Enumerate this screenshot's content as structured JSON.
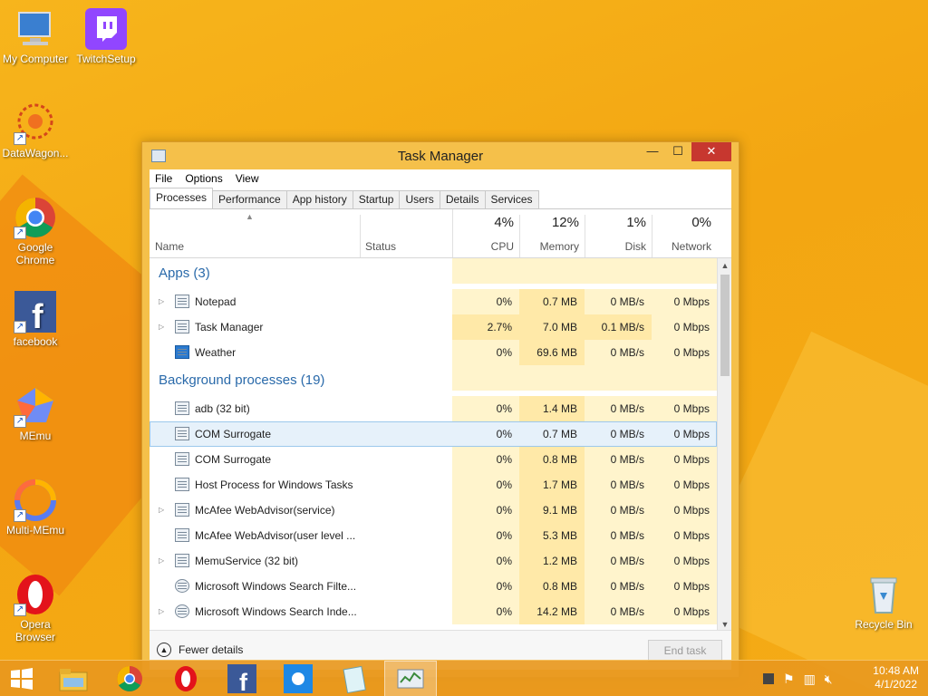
{
  "desktop": {
    "icons": [
      {
        "label": "My Computer",
        "icon": "computer-icon"
      },
      {
        "label": "TwitchSetup",
        "icon": "twitch-icon"
      },
      {
        "label": "DataWagon...",
        "icon": "datawagon-icon"
      },
      {
        "label": "Google Chrome",
        "icon": "chrome-icon"
      },
      {
        "label": "facebook",
        "icon": "facebook-icon"
      },
      {
        "label": "MEmu",
        "icon": "memu-icon"
      },
      {
        "label": "Multi-MEmu",
        "icon": "multi-memu-icon"
      },
      {
        "label": "Opera Browser",
        "icon": "opera-icon"
      },
      {
        "label": "Recycle Bin",
        "icon": "recycle-bin-icon"
      }
    ]
  },
  "window": {
    "title": "Task Manager",
    "controls": {
      "minimize": "—",
      "maximize": "☐",
      "close": "✕"
    }
  },
  "menu": [
    "File",
    "Options",
    "View"
  ],
  "tabs": [
    "Processes",
    "Performance",
    "App history",
    "Startup",
    "Users",
    "Details",
    "Services"
  ],
  "columns": {
    "name": "Name",
    "status": "Status",
    "cpu": {
      "pct": "4%",
      "label": "CPU"
    },
    "memory": {
      "pct": "12%",
      "label": "Memory"
    },
    "disk": {
      "pct": "1%",
      "label": "Disk"
    },
    "network": {
      "pct": "0%",
      "label": "Network"
    }
  },
  "groups": {
    "apps": "Apps (3)",
    "background": "Background processes (19)"
  },
  "apps": [
    {
      "name": "Notepad",
      "cpu": "0%",
      "mem": "0.7 MB",
      "disk": "0 MB/s",
      "net": "0 Mbps"
    },
    {
      "name": "Task Manager",
      "cpu": "2.7%",
      "mem": "7.0 MB",
      "disk": "0.1 MB/s",
      "net": "0 Mbps"
    },
    {
      "name": "Weather",
      "cpu": "0%",
      "mem": "69.6 MB",
      "disk": "0 MB/s",
      "net": "0 Mbps"
    }
  ],
  "background": [
    {
      "name": "adb (32 bit)",
      "cpu": "0%",
      "mem": "1.4 MB",
      "disk": "0 MB/s",
      "net": "0 Mbps"
    },
    {
      "name": "COM Surrogate",
      "cpu": "0%",
      "mem": "0.7 MB",
      "disk": "0 MB/s",
      "net": "0 Mbps"
    },
    {
      "name": "COM Surrogate",
      "cpu": "0%",
      "mem": "0.8 MB",
      "disk": "0 MB/s",
      "net": "0 Mbps"
    },
    {
      "name": "Host Process for Windows Tasks",
      "cpu": "0%",
      "mem": "1.7 MB",
      "disk": "0 MB/s",
      "net": "0 Mbps"
    },
    {
      "name": "McAfee WebAdvisor(service)",
      "cpu": "0%",
      "mem": "9.1 MB",
      "disk": "0 MB/s",
      "net": "0 Mbps"
    },
    {
      "name": "McAfee WebAdvisor(user level ...",
      "cpu": "0%",
      "mem": "5.3 MB",
      "disk": "0 MB/s",
      "net": "0 Mbps"
    },
    {
      "name": "MemuService (32 bit)",
      "cpu": "0%",
      "mem": "1.2 MB",
      "disk": "0 MB/s",
      "net": "0 Mbps"
    },
    {
      "name": "Microsoft Windows Search Filte...",
      "cpu": "0%",
      "mem": "0.8 MB",
      "disk": "0 MB/s",
      "net": "0 Mbps"
    },
    {
      "name": "Microsoft Windows Search Inde...",
      "cpu": "0%",
      "mem": "14.2 MB",
      "disk": "0 MB/s",
      "net": "0 Mbps"
    }
  ],
  "footer": {
    "fewer": "Fewer details",
    "end_task": "End task"
  },
  "clock": {
    "time": "10:48 AM",
    "date": "4/1/2022"
  },
  "colors": {
    "accent": "#2a6aaa",
    "close": "#c7372f",
    "taskbar": "#e8981e"
  }
}
